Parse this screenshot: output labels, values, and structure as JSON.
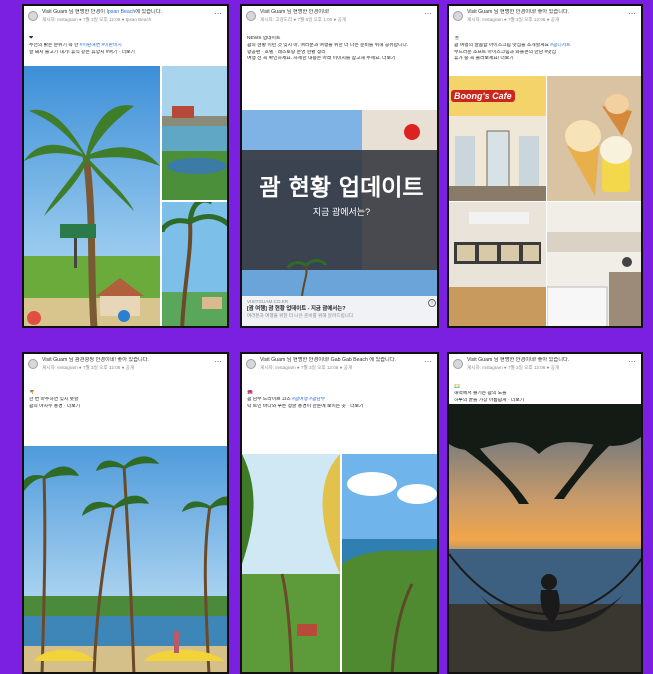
{
  "colors": {
    "background": "#7b1fe0",
    "link": "#2b6fd6"
  },
  "posts": [
    {
      "title": "Visit Guam 님 현명한 안경이 ",
      "title_link": "Ipsan Beach",
      "title_tail": "에 있습니다.",
      "subtitle": "게시자: Instagram ● 7월 3일 오후 12:06 ● Ipsan Beach",
      "lines": [
        {
          "text": "❤"
        },
        {
          "text": "주전의 밝은 분위기 속 한 ",
          "link": "#이판해변 #이판비치"
        },
        {
          "text": "알 돼지 물고기 내기! 휴식 같은 휴양지 #여기 · 더보기"
        }
      ]
    },
    {
      "title": "Visit Guam 님 현명한 안경이네!",
      "title_link": "",
      "title_tail": "",
      "subtitle": "게시자: 고감도리 ● 7월 5일 오후 1:00 ● 공개",
      "lines": [
        {
          "text": "NEWS 업데이트"
        },
        {
          "text": "괌의 현황 이런 것 잊지 마, 여러분과 여행을 위한 더 나은 준비를 위해 공유합니다."
        },
        {
          "text": "항공편 · 호텔 · 레스토랑 운영 현황 정리"
        },
        {
          "text": "여행 전 꼭 확인하세요. 자세한 내용은 아래 이미지를 참고해 주세요. 더보기"
        }
      ],
      "banner_title": "괌 현황 업데이트",
      "banner_sub": "지금 괌에서는?",
      "link_domain": "VISITGUAM.CO.KR",
      "link_title": "[괌 여행] 괌 현황 업데이트 - 지금 괌에서는?",
      "link_desc": "여러분과 여행을 위한 더 나은 준비를 위해 알려드립니다."
    },
    {
      "title": "Visit Guam 님 현명한 안경이네! 좋아 있습니다.",
      "title_link": "",
      "title_tail": "",
      "subtitle": "게시자: Instagram ● 7월 3일 오후 12:06 ● 공개",
      "lines": [
        {
          "text": "☕"
        },
        {
          "text": "괌 여행의 달콤함 아이스크림 맛집을 소개할게요 ",
          "link": "#괌디저트"
        },
        {
          "text": "부드러운 소프트 아이스크림과 와플콘의 만남 #맛집"
        },
        {
          "text": "휴가 중 꼭 들러보세요! 더보기"
        }
      ],
      "shop_sign": "Boong's Cafe"
    },
    {
      "title": "Visit Guam 님 괌관광청 안경이네! 좋아 있습니다.",
      "title_link": "",
      "title_tail": "",
      "subtitle": "게시자: Instagram ● 7월 3일 오후 12:06 ● 공개",
      "lines": [
        {
          "text": "🌴"
        },
        {
          "text": "한 번 마주하면 잊지 못할"
        },
        {
          "text": "괌의 야자수 풍경 · 더보기"
        }
      ]
    },
    {
      "title": "Visit Guam 님 현명한 안경이네! Gab Gab Beach 에 있습니다.",
      "title_link": "",
      "title_tail": "",
      "subtitle": "게시자: Instagram ● 7월 3일 오후 12:06 ● 공개",
      "lines": [
        {
          "text": "🌺"
        },
        {
          "text": "괌 남부 드라이브 코스 ",
          "link": "#괌여행 #괌남부"
        },
        {
          "text": "탁 트인 바다와 푸른 정글 풍경이 한눈에 보이는 곳 · 더보기"
        }
      ]
    },
    {
      "title": "Visit Guam 님 현명한 안경이네! 좋아 있습니다.",
      "title_link": "",
      "title_tail": "",
      "subtitle": "게시자: Instagram ● 7월 3일 오후 12:06 ● 공개",
      "lines": [
        {
          "text": "🌅"
        },
        {
          "text": "해먹에서 즐기는 괌의 노을"
        },
        {
          "text": "하루의 끝을 가장 아름답게 · 더보기"
        }
      ]
    }
  ]
}
